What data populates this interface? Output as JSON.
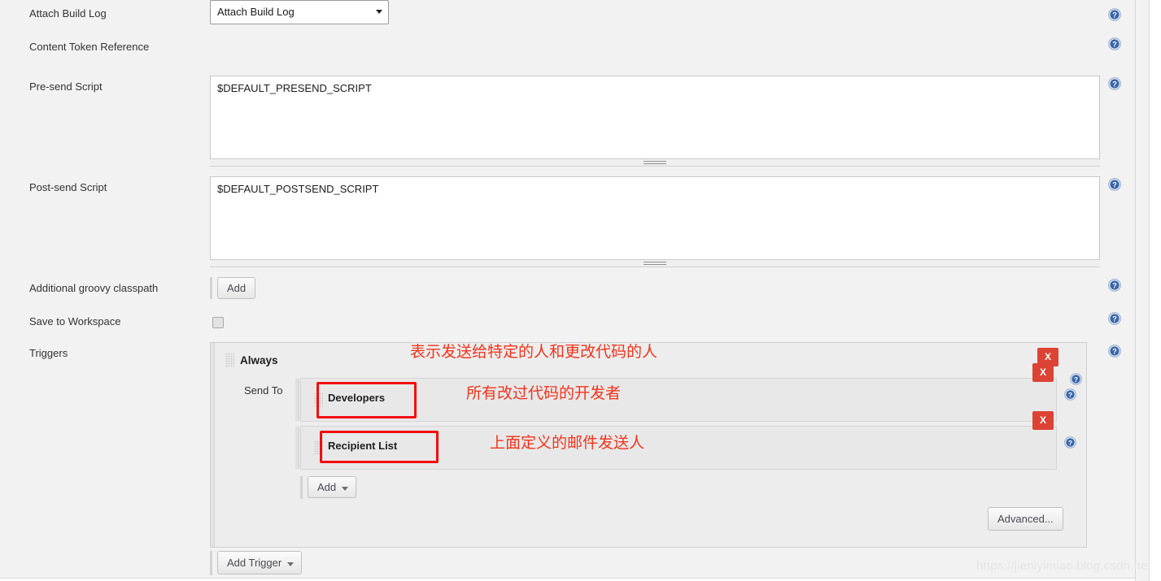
{
  "rows": {
    "attach_build_log": {
      "label": "Attach Build Log",
      "selected": "Attach Build Log"
    },
    "content_token_reference": {
      "label": "Content Token Reference"
    },
    "presend_script": {
      "label": "Pre-send Script",
      "value": "$DEFAULT_PRESEND_SCRIPT"
    },
    "postsend_script": {
      "label": "Post-send Script",
      "value": "$DEFAULT_POSTSEND_SCRIPT"
    },
    "groovy_classpath": {
      "label": "Additional groovy classpath",
      "add_label": "Add"
    },
    "save_to_workspace": {
      "label": "Save to Workspace",
      "checked": false
    },
    "triggers": {
      "label": "Triggers"
    }
  },
  "trigger": {
    "title": "Always",
    "send_to_label": "Send To",
    "recipients": [
      {
        "name": "Developers",
        "remove_label": "X"
      },
      {
        "name": "Recipient List",
        "remove_label": "X"
      }
    ],
    "remove_trigger_label": "X",
    "add_recipient_label": "Add",
    "advanced_label": "Advanced...",
    "add_trigger_label": "Add Trigger"
  },
  "annotations": [
    {
      "text": "表示发送给特定的人和更改代码的人"
    },
    {
      "text": "所有改过代码的开发者"
    },
    {
      "text": "上面定义的邮件发送人"
    }
  ],
  "watermark": "https://jieniyimiao.blog.csdn.net",
  "icons": {
    "help": "help-circle-icon",
    "dropdown": "chevron-down-icon"
  },
  "colors": {
    "accent_red": "#dc4335",
    "annotation_red": "#f4331b",
    "help_blue": "#3a66a8",
    "page_bg": "#f2f2f2"
  }
}
